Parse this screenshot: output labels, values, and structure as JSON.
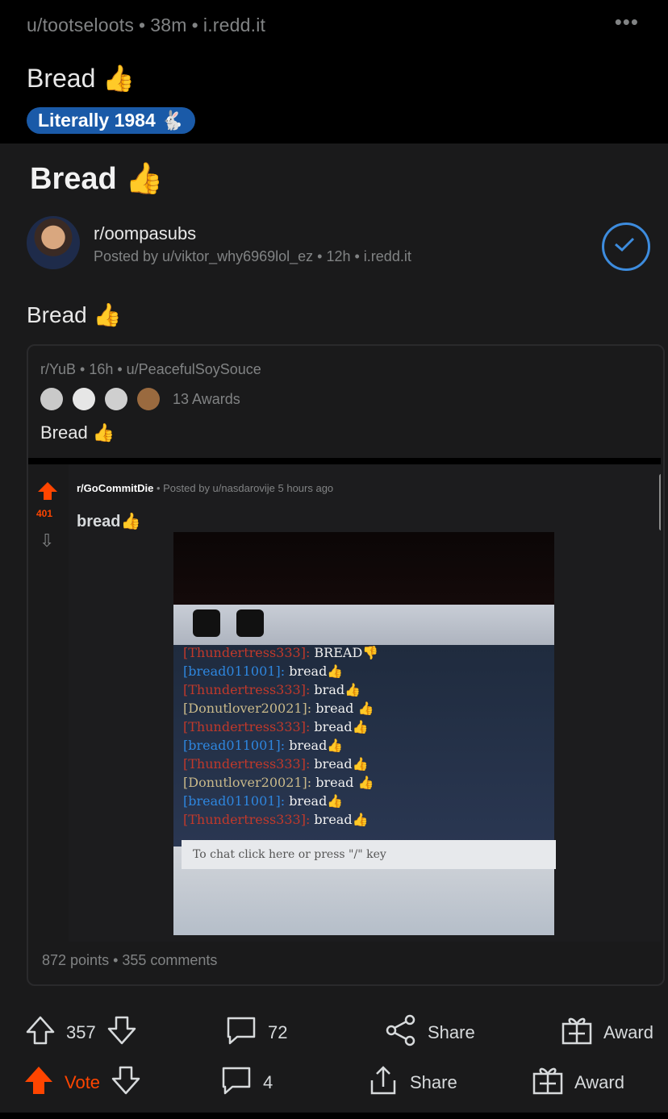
{
  "header": {
    "user": "u/tootseloots",
    "age": "38m",
    "domain": "i.redd.it",
    "more": "•••"
  },
  "post": {
    "title": "Bread 👍",
    "flair": "Literally 1984 🐇"
  },
  "crosspost": {
    "title": "Bread 👍",
    "subreddit": "r/oompasubs",
    "posted_by": "Posted by u/viktor_why6969lol_ez • 12h • i.redd.it",
    "body": "Bread 👍",
    "inner": {
      "meta": "r/YuB • 16h • u/PeacefulSoySouce",
      "awards_label": "13 Awards",
      "body": "Bread 👍",
      "screenshot": {
        "votes": "401",
        "subreddit": "r/GoCommitDie",
        "posted": "• Posted by u/nasdarovije 5 hours ago",
        "title": "bread👍",
        "chat": [
          {
            "name": "[Thundertress333]:",
            "msg": "BREAD👎",
            "color": "#c0392b"
          },
          {
            "name": "[bread011001]:",
            "msg": "bread👍",
            "color": "#2e86de"
          },
          {
            "name": "[Thundertress333]:",
            "msg": "brad👍",
            "color": "#c0392b"
          },
          {
            "name": "[Donutlover20021]:",
            "msg": "bread 👍",
            "color": "#c9b98a"
          },
          {
            "name": "[Thundertress333]:",
            "msg": "bread👍",
            "color": "#c0392b"
          },
          {
            "name": "[bread011001]:",
            "msg": "bread👍",
            "color": "#2e86de"
          },
          {
            "name": "[Thundertress333]:",
            "msg": "bread👍",
            "color": "#c0392b"
          },
          {
            "name": "[Donutlover20021]:",
            "msg": "bread 👍",
            "color": "#c9b98a"
          },
          {
            "name": "[bread011001]:",
            "msg": "bread👍",
            "color": "#2e86de"
          },
          {
            "name": "[Thundertress333]:",
            "msg": "bread👍",
            "color": "#c0392b"
          }
        ],
        "chat_placeholder": "To chat click here or press \"/\" key"
      },
      "points": "872 points • 355 comments"
    }
  },
  "actions_row1": {
    "votes": "357",
    "comments": "72",
    "share": "Share",
    "award": "Award"
  },
  "actions_row2": {
    "vote": "Vote",
    "comments": "4",
    "share": "Share",
    "award": "Award"
  },
  "colors": {
    "accent": "#ff4500",
    "flair": "#1a5aa8",
    "check": "#3d8cde"
  }
}
